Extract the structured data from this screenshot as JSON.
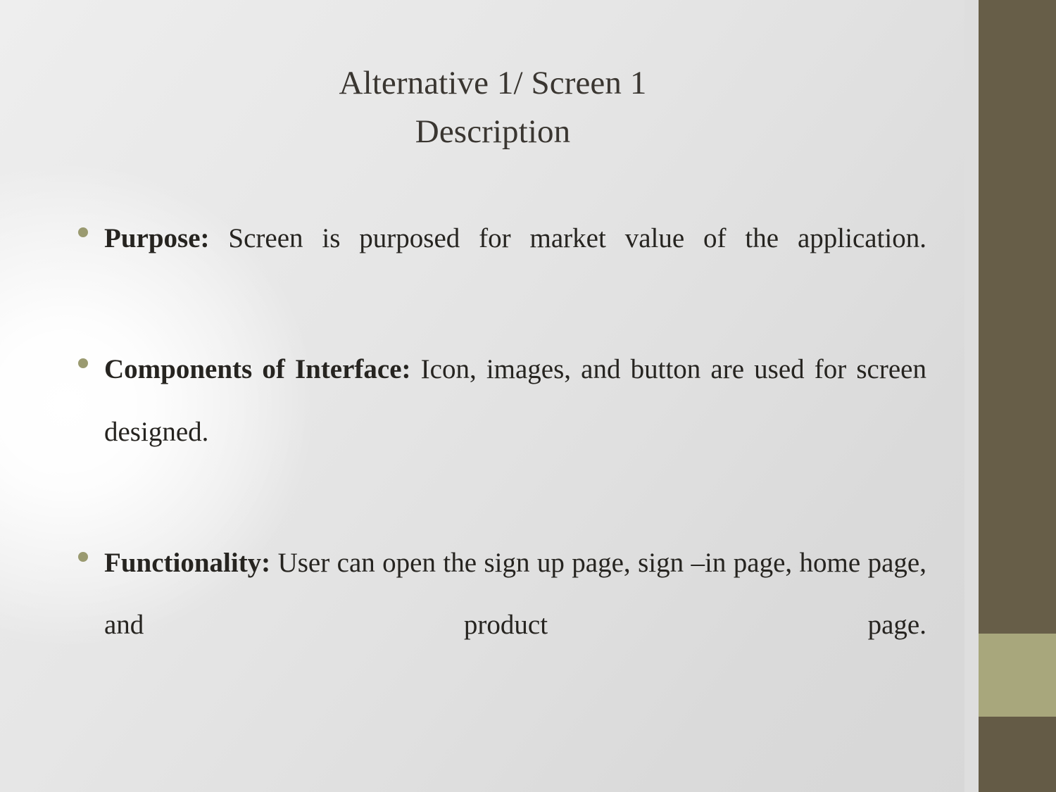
{
  "slide": {
    "title": {
      "line1": "Alternative 1/ Screen 1",
      "line2": "Description"
    },
    "bullets": [
      {
        "lead": "Purpose:",
        "text": " Screen is purposed for market value of the application."
      },
      {
        "lead": "Components of Interface:",
        "text": " Icon, images, and button are used for screen  designed."
      },
      {
        "lead": "Functionality:",
        "text": " User can open the sign up page, sign –in page, home page, and product page."
      }
    ],
    "colors": {
      "title_text": "#3a3631",
      "body_text": "#262420",
      "bullet_dot": "#9a9a70",
      "sidebar_dark": "#675e48",
      "sidebar_khaki": "#a8a77c",
      "background_light": "#eeeeee",
      "background_shade": "#d7d7d7"
    }
  }
}
